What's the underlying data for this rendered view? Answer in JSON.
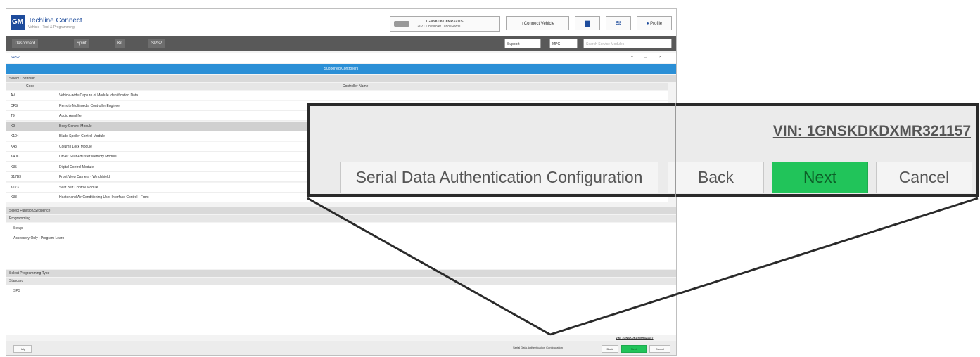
{
  "background_app": {
    "title": "Techline Connect",
    "subtitle": "Vehicle · Tool & Programming",
    "vin_summary": "1GNSKDKDXMR321157",
    "vehicle_line": "2021 Chevrolet Tahoe 4WD",
    "connect_vehicle_label": "Connect Vehicle",
    "user_label": "Profile",
    "nav_tabs": [
      "Dashboard",
      "Spirit",
      "Kit",
      "SPS2"
    ],
    "support_select": "Support",
    "mode_select": "MPG",
    "search_placeholder": "Search Service Modules",
    "breadcrumb": "SPS2",
    "blue_title": "Supported Controllers",
    "section_controllers": "Select Controller",
    "col_code": "Code",
    "col_controller": "Controller Name",
    "rows": [
      {
        "code": "AV",
        "name": "Vehicle-wide Capture of Module Identification Data"
      },
      {
        "code": "CFS",
        "name": "Remote Multimedia Controller Engineer"
      },
      {
        "code": "T9",
        "name": "Audio Amplifier"
      },
      {
        "code": "K9",
        "name": "Body Control Module"
      },
      {
        "code": "K104",
        "name": "Blade Spoiler Control Module"
      },
      {
        "code": "K43",
        "name": "Column Lock Module"
      },
      {
        "code": "K40C",
        "name": "Driver Seat Adjuster Memory Module"
      },
      {
        "code": "K35",
        "name": "Digital Control Module"
      },
      {
        "code": "B17B3",
        "name": "Front View Camera - Windshield"
      },
      {
        "code": "K173",
        "name": "Seat Belt Control Module"
      },
      {
        "code": "K33",
        "name": "Heater and Air Conditioning User Interface Control - Front"
      }
    ],
    "section_function": "Select Function/Sequence",
    "function_head": "Programming",
    "function_items": [
      "Setup",
      "Accessory Only : Program Learn"
    ],
    "section_programming": "Select Programming Type",
    "programming_head": "Standard",
    "programming_items": [
      "SPS"
    ],
    "footer_vin": "VIN: 1GNSKDKDXMR321157",
    "help_label": "Help",
    "mini_config": "Serial Data Authentication Configuration",
    "mini_back": "Back",
    "mini_next": "Next",
    "mini_cancel": "Cancel"
  },
  "callout": {
    "vin": "VIN: 1GNSKDKDXMR321157",
    "config_button": "Serial Data Authentication Configuration",
    "back_button": "Back",
    "next_button": "Next",
    "cancel_button": "Cancel"
  },
  "colors": {
    "next_green": "#21c45a",
    "nav_dark": "#595959",
    "header_blue": "#2b8fd6",
    "brand_blue": "#1e4c9c"
  }
}
